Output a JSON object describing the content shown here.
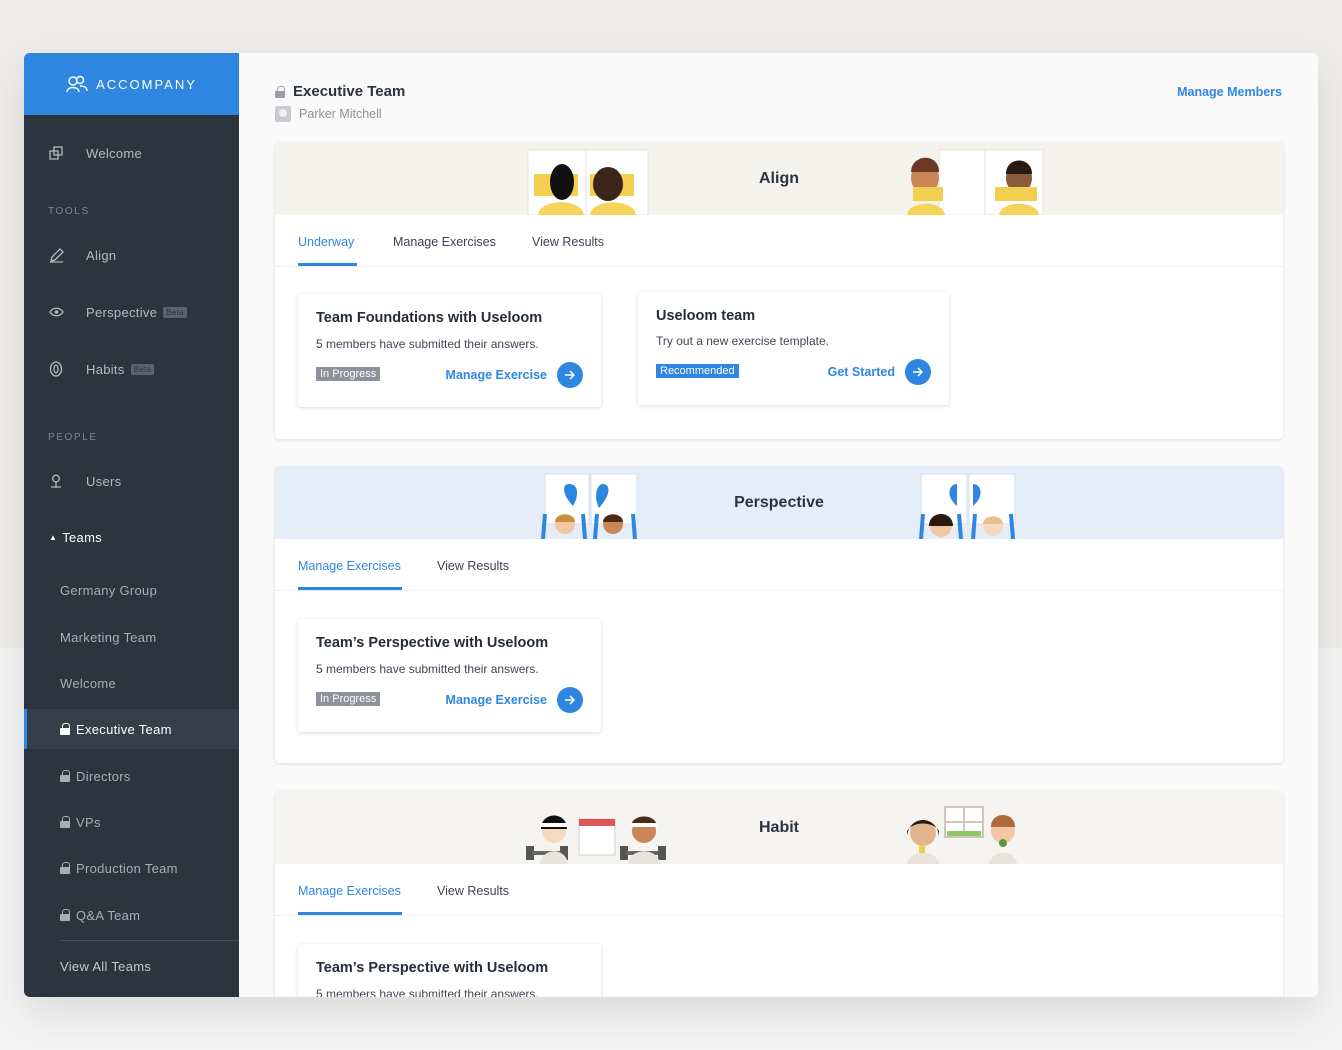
{
  "brand": {
    "name": "ACCOMPANY"
  },
  "sidebar": {
    "welcome": "Welcome",
    "tools_heading": "TOOLS",
    "tools": [
      {
        "label": "Align",
        "beta": ""
      },
      {
        "label": "Perspective",
        "beta": "Beta"
      },
      {
        "label": "Habits",
        "beta": "Beta"
      }
    ],
    "people_heading": "PEOPLE",
    "users": "Users",
    "teams_toggle": "Teams",
    "teams": [
      {
        "label": "Germany Group",
        "locked": false
      },
      {
        "label": "Marketing Team",
        "locked": false
      },
      {
        "label": "Welcome",
        "locked": false
      },
      {
        "label": "Executive Team",
        "locked": true,
        "active": true
      },
      {
        "label": "Directors",
        "locked": true
      },
      {
        "label": "VPs",
        "locked": true
      },
      {
        "label": "Production Team",
        "locked": true
      },
      {
        "label": "Q&A Team",
        "locked": true
      }
    ],
    "view_all": "View All Teams"
  },
  "header": {
    "title": "Executive Team",
    "owner": "Parker Mitchell",
    "manage_members": "Manage Members"
  },
  "sections": [
    {
      "title": "Align",
      "tabs": [
        "Underway",
        "Manage Exercises",
        "View Results"
      ],
      "exercises": [
        {
          "title": "Team Foundations with Useloom",
          "desc": "5 members have submitted their answers.",
          "status": "In Progress",
          "action": "Manage Exercise"
        },
        {
          "title": "Useloom team",
          "desc": "Try out a new exercise template.",
          "status": "Recommended",
          "action": "Get Started"
        }
      ]
    },
    {
      "title": "Perspective",
      "tabs": [
        "Manage Exercises",
        "View Results"
      ],
      "exercises": [
        {
          "title": "Team’s Perspective with Useloom",
          "desc": "5 members have submitted their answers.",
          "status": "In Progress",
          "action": "Manage Exercise"
        }
      ]
    },
    {
      "title": "Habit",
      "tabs": [
        "Manage Exercises",
        "View Results"
      ],
      "exercises": [
        {
          "title": "Team’s Perspective with Useloom",
          "desc": "5 members have submitted their answers."
        }
      ]
    }
  ],
  "colors": {
    "accent": "#2f86e0",
    "sidebar_bg": "#2c3440",
    "align_banner": "#f5f3ee",
    "perspective_banner": "#e4edf8",
    "habit_banner": "#f5f4f1"
  }
}
